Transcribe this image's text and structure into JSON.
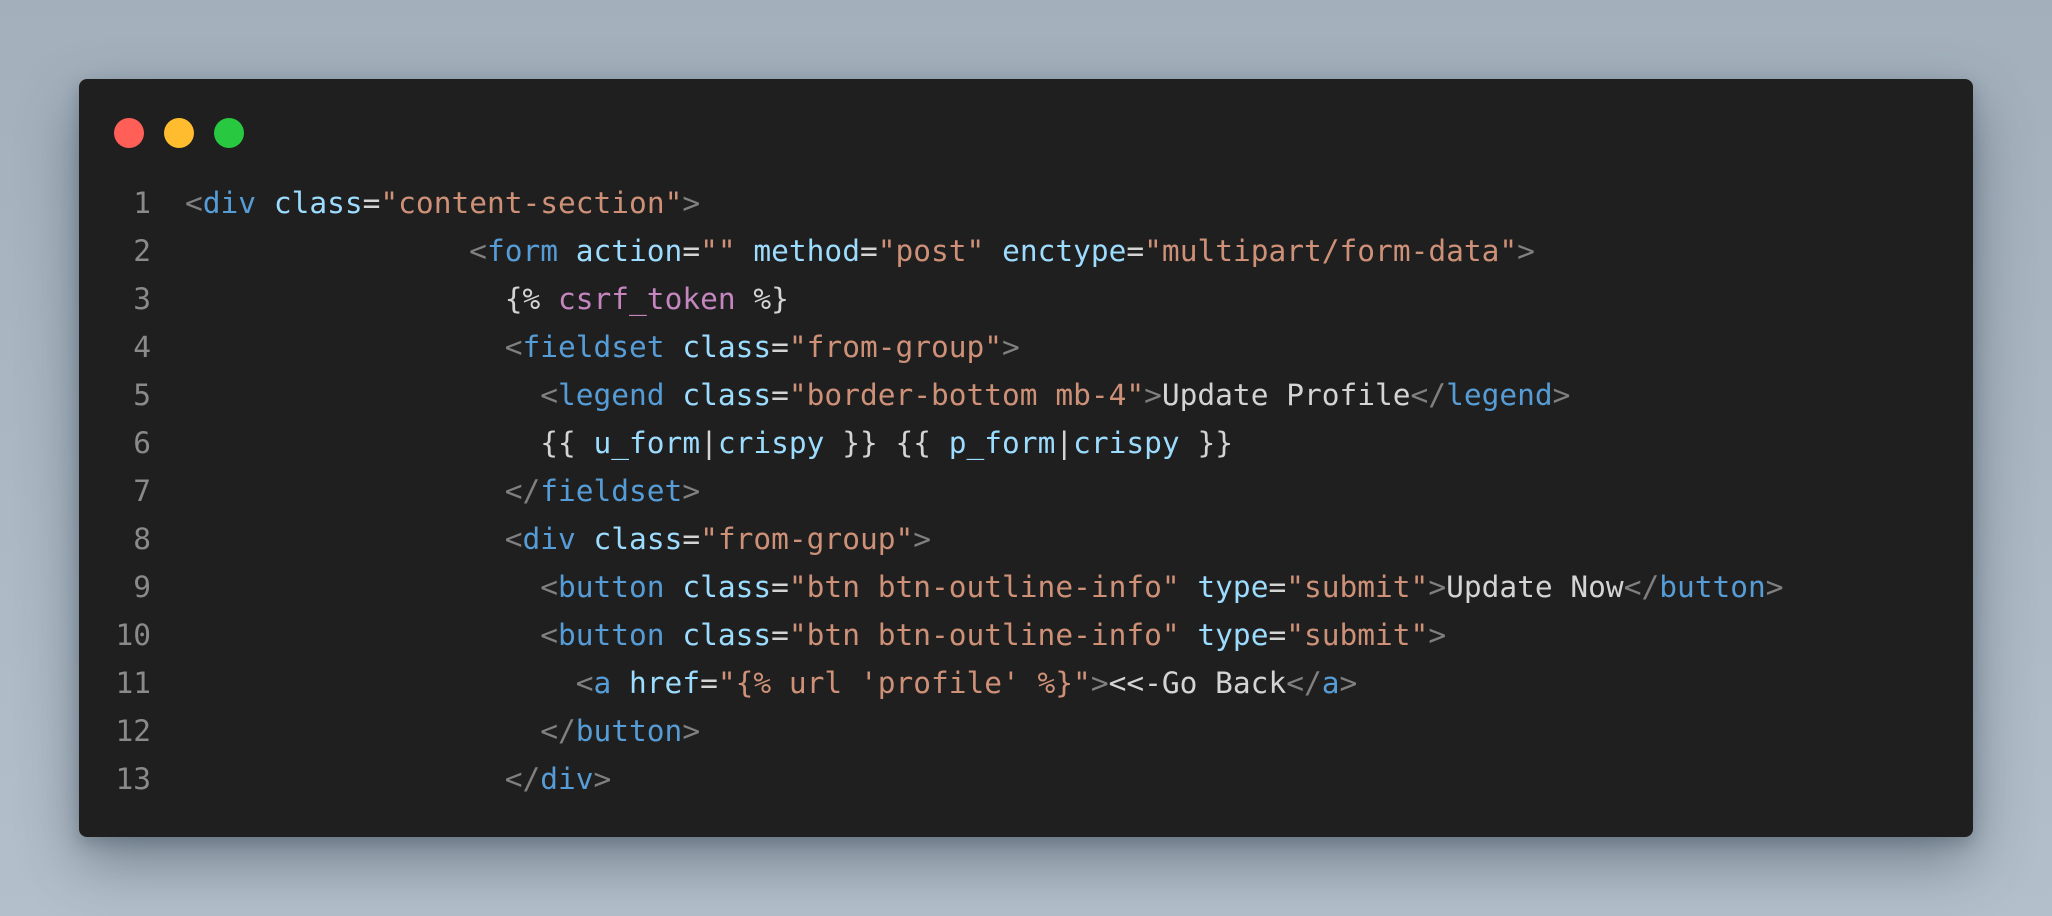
{
  "window": {
    "controls": [
      "close",
      "minimize",
      "zoom"
    ]
  },
  "colors": {
    "punct": "#808080",
    "tag": "#569cd6",
    "attr": "#9cdcfe",
    "str": "#ce9178",
    "text": "#d4d4d4",
    "kw": "#c586c0",
    "var": "#9cdcfe"
  },
  "code": {
    "lines": [
      {
        "number": "1",
        "indent": "",
        "tokens": [
          {
            "t": "punct",
            "v": "<"
          },
          {
            "t": "tag",
            "v": "div"
          },
          {
            "t": "text",
            "v": " "
          },
          {
            "t": "attr",
            "v": "class"
          },
          {
            "t": "text",
            "v": "="
          },
          {
            "t": "str",
            "v": "\"content-section\""
          },
          {
            "t": "punct",
            "v": ">"
          }
        ]
      },
      {
        "number": "2",
        "indent": "                ",
        "tokens": [
          {
            "t": "punct",
            "v": "<"
          },
          {
            "t": "tag",
            "v": "form"
          },
          {
            "t": "text",
            "v": " "
          },
          {
            "t": "attr",
            "v": "action"
          },
          {
            "t": "text",
            "v": "="
          },
          {
            "t": "str",
            "v": "\"\""
          },
          {
            "t": "text",
            "v": " "
          },
          {
            "t": "attr",
            "v": "method"
          },
          {
            "t": "text",
            "v": "="
          },
          {
            "t": "str",
            "v": "\"post\""
          },
          {
            "t": "text",
            "v": " "
          },
          {
            "t": "attr",
            "v": "enctype"
          },
          {
            "t": "text",
            "v": "="
          },
          {
            "t": "str",
            "v": "\"multipart/form-data\""
          },
          {
            "t": "punct",
            "v": ">"
          }
        ]
      },
      {
        "number": "3",
        "indent": "                  ",
        "tokens": [
          {
            "t": "text",
            "v": "{% "
          },
          {
            "t": "kw",
            "v": "csrf_token"
          },
          {
            "t": "text",
            "v": " %}"
          }
        ]
      },
      {
        "number": "4",
        "indent": "                  ",
        "tokens": [
          {
            "t": "punct",
            "v": "<"
          },
          {
            "t": "tag",
            "v": "fieldset"
          },
          {
            "t": "text",
            "v": " "
          },
          {
            "t": "attr",
            "v": "class"
          },
          {
            "t": "text",
            "v": "="
          },
          {
            "t": "str",
            "v": "\"from-group\""
          },
          {
            "t": "punct",
            "v": ">"
          }
        ]
      },
      {
        "number": "5",
        "indent": "                    ",
        "tokens": [
          {
            "t": "punct",
            "v": "<"
          },
          {
            "t": "tag",
            "v": "legend"
          },
          {
            "t": "text",
            "v": " "
          },
          {
            "t": "attr",
            "v": "class"
          },
          {
            "t": "text",
            "v": "="
          },
          {
            "t": "str",
            "v": "\"border-bottom mb-4\""
          },
          {
            "t": "punct",
            "v": ">"
          },
          {
            "t": "text",
            "v": "Update Profile"
          },
          {
            "t": "punct",
            "v": "</"
          },
          {
            "t": "tag",
            "v": "legend"
          },
          {
            "t": "punct",
            "v": ">"
          }
        ]
      },
      {
        "number": "6",
        "indent": "                    ",
        "tokens": [
          {
            "t": "text",
            "v": "{{ "
          },
          {
            "t": "var",
            "v": "u_form"
          },
          {
            "t": "text",
            "v": "|"
          },
          {
            "t": "var",
            "v": "crispy"
          },
          {
            "t": "text",
            "v": " }} {{ "
          },
          {
            "t": "var",
            "v": "p_form"
          },
          {
            "t": "text",
            "v": "|"
          },
          {
            "t": "var",
            "v": "crispy"
          },
          {
            "t": "text",
            "v": " }}"
          }
        ]
      },
      {
        "number": "7",
        "indent": "                  ",
        "tokens": [
          {
            "t": "punct",
            "v": "</"
          },
          {
            "t": "tag",
            "v": "fieldset"
          },
          {
            "t": "punct",
            "v": ">"
          }
        ]
      },
      {
        "number": "8",
        "indent": "                  ",
        "tokens": [
          {
            "t": "punct",
            "v": "<"
          },
          {
            "t": "tag",
            "v": "div"
          },
          {
            "t": "text",
            "v": " "
          },
          {
            "t": "attr",
            "v": "class"
          },
          {
            "t": "text",
            "v": "="
          },
          {
            "t": "str",
            "v": "\"from-group\""
          },
          {
            "t": "punct",
            "v": ">"
          }
        ]
      },
      {
        "number": "9",
        "indent": "                    ",
        "tokens": [
          {
            "t": "punct",
            "v": "<"
          },
          {
            "t": "tag",
            "v": "button"
          },
          {
            "t": "text",
            "v": " "
          },
          {
            "t": "attr",
            "v": "class"
          },
          {
            "t": "text",
            "v": "="
          },
          {
            "t": "str",
            "v": "\"btn btn-outline-info\""
          },
          {
            "t": "text",
            "v": " "
          },
          {
            "t": "attr",
            "v": "type"
          },
          {
            "t": "text",
            "v": "="
          },
          {
            "t": "str",
            "v": "\"submit\""
          },
          {
            "t": "punct",
            "v": ">"
          },
          {
            "t": "text",
            "v": "Update Now"
          },
          {
            "t": "punct",
            "v": "</"
          },
          {
            "t": "tag",
            "v": "button"
          },
          {
            "t": "punct",
            "v": ">"
          }
        ]
      },
      {
        "number": "10",
        "indent": "                    ",
        "tokens": [
          {
            "t": "punct",
            "v": "<"
          },
          {
            "t": "tag",
            "v": "button"
          },
          {
            "t": "text",
            "v": " "
          },
          {
            "t": "attr",
            "v": "class"
          },
          {
            "t": "text",
            "v": "="
          },
          {
            "t": "str",
            "v": "\"btn btn-outline-info\""
          },
          {
            "t": "text",
            "v": " "
          },
          {
            "t": "attr",
            "v": "type"
          },
          {
            "t": "text",
            "v": "="
          },
          {
            "t": "str",
            "v": "\"submit\""
          },
          {
            "t": "punct",
            "v": ">"
          }
        ]
      },
      {
        "number": "11",
        "indent": "                      ",
        "tokens": [
          {
            "t": "punct",
            "v": "<"
          },
          {
            "t": "tag",
            "v": "a"
          },
          {
            "t": "text",
            "v": " "
          },
          {
            "t": "attr",
            "v": "href"
          },
          {
            "t": "text",
            "v": "="
          },
          {
            "t": "str",
            "v": "\"{% url 'profile' %}\""
          },
          {
            "t": "punct",
            "v": ">"
          },
          {
            "t": "text",
            "v": "<<-Go Back"
          },
          {
            "t": "punct",
            "v": "</"
          },
          {
            "t": "tag",
            "v": "a"
          },
          {
            "t": "punct",
            "v": ">"
          }
        ]
      },
      {
        "number": "12",
        "indent": "                    ",
        "tokens": [
          {
            "t": "punct",
            "v": "</"
          },
          {
            "t": "tag",
            "v": "button"
          },
          {
            "t": "punct",
            "v": ">"
          }
        ]
      },
      {
        "number": "13",
        "indent": "                  ",
        "tokens": [
          {
            "t": "punct",
            "v": "</"
          },
          {
            "t": "tag",
            "v": "div"
          },
          {
            "t": "punct",
            "v": ">"
          }
        ]
      }
    ]
  }
}
